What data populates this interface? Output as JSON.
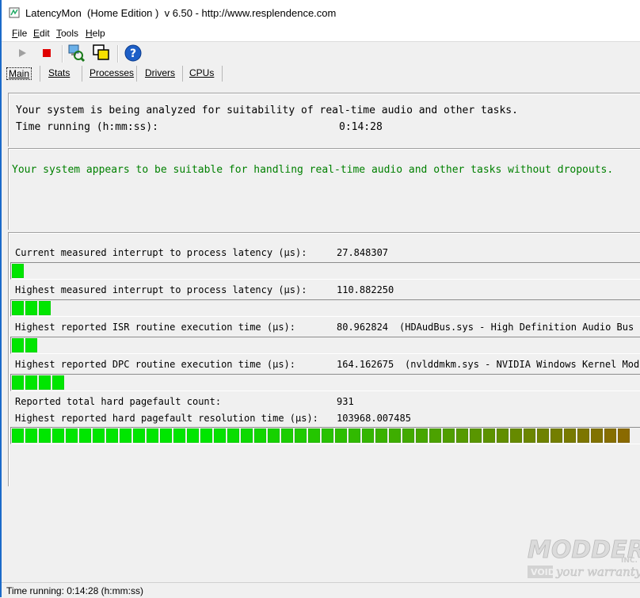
{
  "window": {
    "title": "LatencyMon  (Home Edition )  v 6.50 - http://www.resplendence.com"
  },
  "menu": [
    {
      "key": "F",
      "rest": "ile"
    },
    {
      "key": "E",
      "rest": "dit"
    },
    {
      "key": "T",
      "rest": "ools"
    },
    {
      "key": "H",
      "rest": "elp"
    }
  ],
  "toolbar": {
    "icons": [
      "play-icon",
      "stop-icon",
      "analyze-icon",
      "windows-icon",
      "help-icon"
    ]
  },
  "tabs": [
    "Main",
    "Stats",
    "Processes",
    "Drivers",
    "CPUs"
  ],
  "status_panel": {
    "analyzing_text": "Your system is being analyzed for suitability of real-time audio and other tasks.",
    "time_label": "Time running (h:mm:ss):",
    "time_value": "0:14:28"
  },
  "verdict": {
    "text": "Your system appears to be suitable for handling real-time audio and other tasks without dropouts.",
    "color": "#008000"
  },
  "metrics": {
    "current_latency": {
      "label": "Current measured interrupt to process latency (µs):",
      "value": "27.848307",
      "segments": 1
    },
    "highest_latency": {
      "label": "Highest measured interrupt to process latency (µs):",
      "value": "110.882250",
      "segments": 3
    },
    "isr": {
      "label": "Highest reported ISR routine execution time (µs):",
      "value": "80.962824",
      "detail": "(HDAudBus.sys - High Definition Audio Bus Dri",
      "segments": 2
    },
    "dpc": {
      "label": "Highest reported DPC routine execution time (µs):",
      "value": "164.162675",
      "detail": "(nvlddmkm.sys - NVIDIA Windows Kernel Mode D",
      "segments": 4
    },
    "pagefault_count": {
      "label": "Reported total hard pagefault count:",
      "value": "931"
    },
    "pagefault_time": {
      "label": "Highest reported hard pagefault resolution time (µs):",
      "value": "103968.007485",
      "segments": 46
    }
  },
  "colors": {
    "bar_green": "#00e600",
    "bar_end": "#8a6a00"
  },
  "statusbar": {
    "text": "Time running: 0:14:28  (h:mm:ss)"
  },
  "watermark": {
    "brand": "MODDERS",
    "suffix": "INC.",
    "tagline_a": "VOID",
    "tagline_b": "your warranty"
  }
}
